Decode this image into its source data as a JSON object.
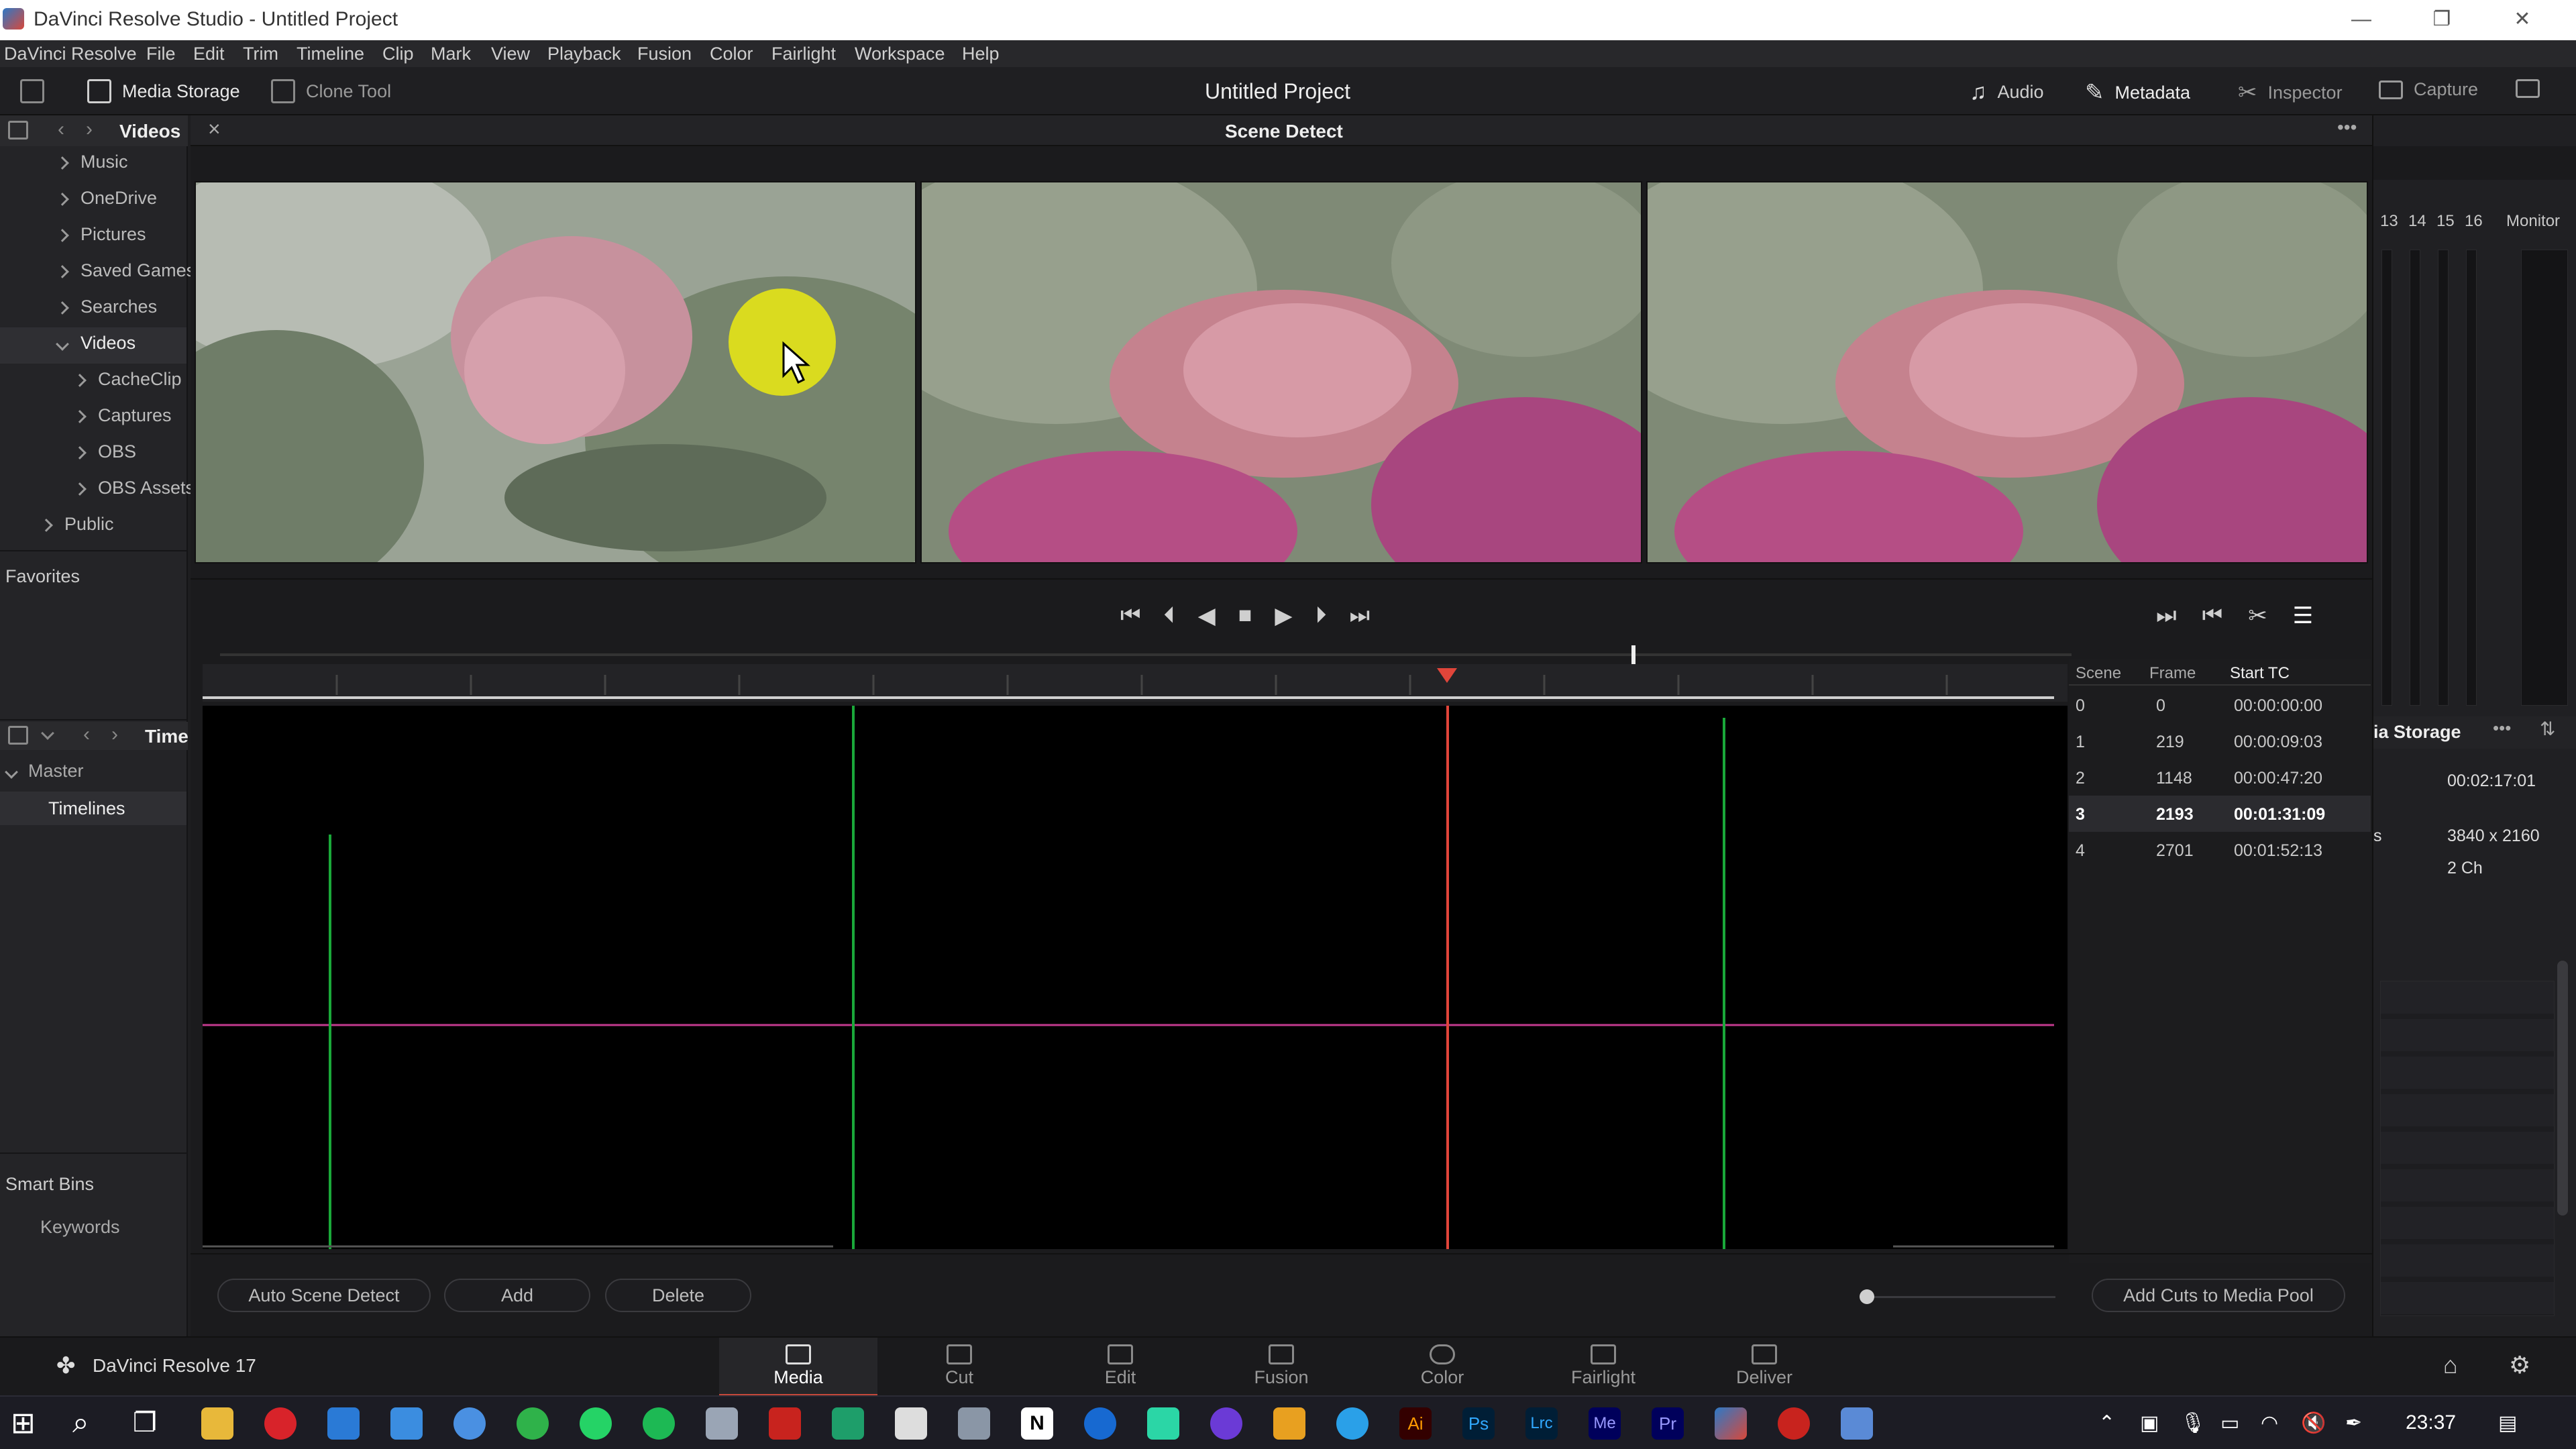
{
  "window": {
    "title": "DaVinci Resolve Studio - Untitled Project",
    "minimize": "—",
    "restore": "❐",
    "close": "✕"
  },
  "menu": [
    "DaVinci Resolve",
    "File",
    "Edit",
    "Trim",
    "Timeline",
    "Clip",
    "Mark",
    "View",
    "Playback",
    "Fusion",
    "Color",
    "Fairlight",
    "Workspace",
    "Help"
  ],
  "toolbar": {
    "media_storage": "Media Storage",
    "clone_tool": "Clone Tool",
    "project_title": "Untitled Project",
    "audio": "Audio",
    "metadata": "Metadata",
    "inspector": "Inspector",
    "capture": "Capture"
  },
  "sidebar": {
    "header": "Videos",
    "folders": [
      "Music",
      "OneDrive",
      "Pictures",
      "Saved Games",
      "Searches",
      "Videos",
      "CacheClip",
      "Captures",
      "OBS",
      "OBS Assets",
      "Public"
    ],
    "favorites": "Favorites",
    "timelines_header": "Time",
    "master": "Master",
    "timelines": "Timelines",
    "smart_bins": "Smart Bins",
    "keywords": "Keywords"
  },
  "scene_detect": {
    "title": "Scene Detect",
    "more": "•••",
    "close": "×"
  },
  "scene_table": {
    "headers": [
      "Scene",
      "Frame",
      "Start TC"
    ],
    "rows": [
      [
        "0",
        "0",
        "00:00:00:00"
      ],
      [
        "1",
        "219",
        "00:00:09:03"
      ],
      [
        "2",
        "1148",
        "00:00:47:20"
      ],
      [
        "3",
        "2193",
        "00:01:31:09"
      ],
      [
        "4",
        "2701",
        "00:01:52:13"
      ]
    ],
    "selected_index": 3
  },
  "buttons": {
    "auto_scene_detect": "Auto Scene Detect",
    "add": "Add",
    "delete": "Delete",
    "add_cuts": "Add Cuts to Media Pool"
  },
  "right_panel": {
    "channels": [
      "13",
      "14",
      "15",
      "16"
    ],
    "monitor": "Monitor",
    "storage_title": "ia Storage",
    "duration": "00:02:17:01",
    "resolution": "3840 x 2160",
    "audio_ch": "2 Ch",
    "s_label": "s"
  },
  "pages": {
    "brand": "DaVinci Resolve 17",
    "items": [
      "Media",
      "Cut",
      "Edit",
      "Fusion",
      "Color",
      "Fairlight",
      "Deliver"
    ],
    "active": "Media"
  },
  "taskbar": {
    "time": "23:37",
    "labels": [
      "N",
      "Ai",
      "Ps",
      "Lrc",
      "Me",
      "Pr"
    ]
  },
  "colors": {
    "accent_red": "#e0453a",
    "cut_green": "#1aa839",
    "threshold": "#c23a8e"
  }
}
